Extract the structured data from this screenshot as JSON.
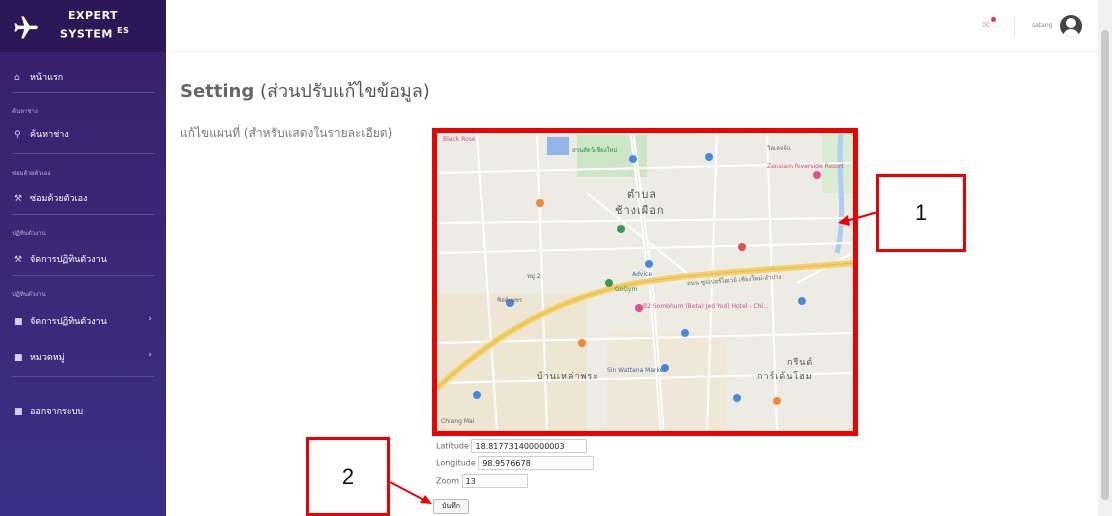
{
  "app": {
    "brand_line1": "EXPERT",
    "brand_line2": "SYSTEM",
    "brand_sup": "ES"
  },
  "sidebar": {
    "home_label": "หน้าแรก",
    "sections": [
      {
        "title": "ค้นหาช่าง",
        "item": "ค้นหาช่าง"
      },
      {
        "title": "ซ่อมด้วยตัวเอง",
        "item": "ซ่อมด้วยตัวเอง"
      },
      {
        "title": "ปฏิทินตัวงาน",
        "item": "จัดการปฏิทินตัวงาน"
      },
      {
        "title": "ปฏิทินตัวงาน",
        "item": "จัดการปฏิทินตัวงาน"
      }
    ],
    "category_label": "หมวดหมู่",
    "logout_label": "ออกจากระบบ"
  },
  "topbar": {
    "username": "satang"
  },
  "main": {
    "title_en": "Setting",
    "title_th": "(ส่วนปรับแก้ไขข้อมูล)",
    "map_heading": "แก้ไขแผนที่ (สำหรับแสดงในรายละเอียด)",
    "map_labels": {
      "district_line1": "ตำบล",
      "district_line2": "ช้างเผือก",
      "subdistrict_line1": "กรีนด์",
      "subdistrict_line2": "การ์เด้นโฮม",
      "moo2": "หมู่ 2",
      "baan_mai": "บ้านเหล่าพระ",
      "black_rose": "Black Rose",
      "zoo": "สวนสัตว์เชียงใหม่",
      "tc": "วิลเลจจ์แ",
      "zensiam": "Zensiam Riverside Resort",
      "advice": "Advice",
      "gogym": "GoGym",
      "b2": "B2 Sombhum (Beta) Jed Yod) Hotel - Chi...",
      "silk": "ซิลค์เพชร",
      "wattana": "Sin Wattana Market",
      "thai_road": "ถนน ซูปเปอร์ไฮเวย์ เชียงใหม่-ลำปาง",
      "chiang_mai": "Chiang Mai"
    },
    "form": {
      "latitude_label": "Latitude",
      "latitude_value": "18.817731400000003",
      "longitude_label": "Longitude",
      "longitude_value": "98.9576678",
      "zoom_label": "Zoom",
      "zoom_value": "13",
      "save_label": "บันทึก"
    }
  },
  "callouts": {
    "one": "1",
    "two": "2"
  },
  "colors": {
    "highlight_red": "#ee0000",
    "sidebar_purple": "#3a1e6b"
  },
  "icons": {
    "brand": "airplane-icon",
    "home": "home-icon",
    "search": "search-icon",
    "wrench": "wrench-icon",
    "folder": "folder-icon",
    "bell": "bell-icon",
    "avatar": "user-avatar-icon"
  }
}
